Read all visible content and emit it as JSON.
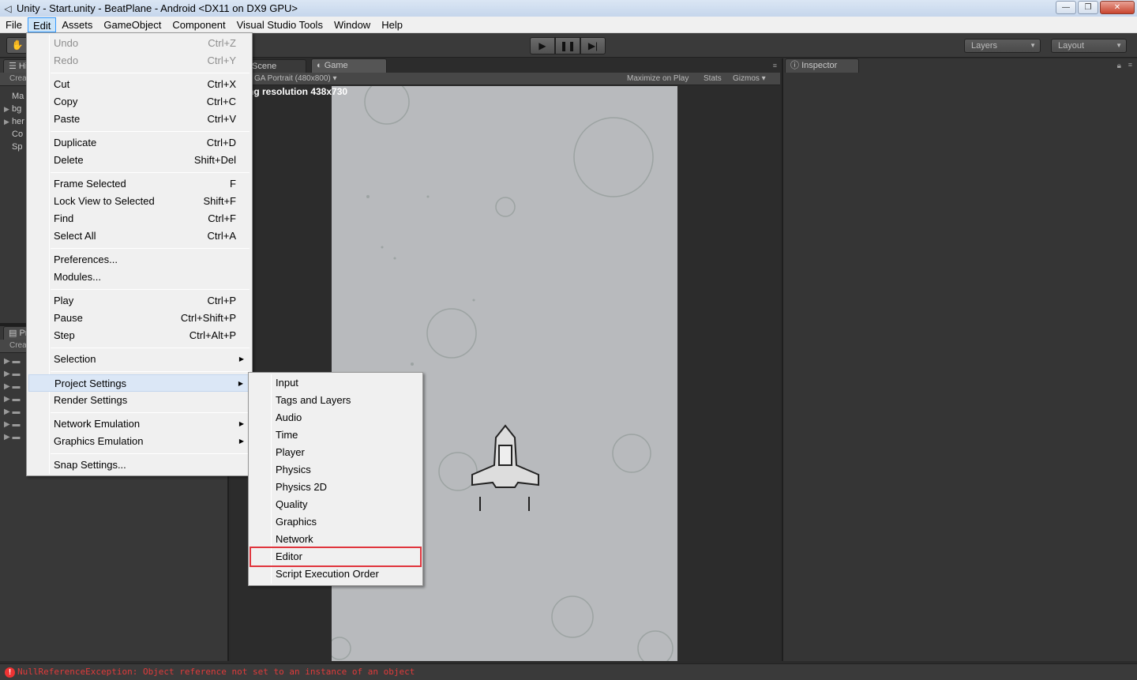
{
  "window": {
    "title": "Unity - Start.unity - BeatPlane - Android <DX11 on DX9 GPU>"
  },
  "menubar": {
    "items": [
      "File",
      "Edit",
      "Assets",
      "GameObject",
      "Component",
      "Visual Studio Tools",
      "Window",
      "Help"
    ]
  },
  "toolbar": {
    "layers_label": "Layers",
    "layout_label": "Layout"
  },
  "hierarchy": {
    "tab_label": "Hi",
    "create_label": "Crea",
    "items": [
      "Ma",
      "bg",
      "her",
      "Co",
      "Sp"
    ]
  },
  "project": {
    "tab_label": "Pr",
    "create_label": "Crea"
  },
  "scene_tabs": {
    "scene_label": "Scene",
    "game_label": "Game"
  },
  "game_bar": {
    "aspect_label": "GA Portrait (480x800)",
    "maximize_label": "Maximize on Play",
    "stats_label": "Stats",
    "gizmos_label": "Gizmos"
  },
  "game_view": {
    "resolution_warning": "ng resolution 438x730"
  },
  "inspector": {
    "tab_label": "Inspector"
  },
  "edit_menu": {
    "items": [
      {
        "label": "Undo",
        "shortcut": "Ctrl+Z",
        "disabled": true
      },
      {
        "label": "Redo",
        "shortcut": "Ctrl+Y",
        "disabled": true
      },
      {
        "label": "Cut",
        "shortcut": "Ctrl+X"
      },
      {
        "label": "Copy",
        "shortcut": "Ctrl+C"
      },
      {
        "label": "Paste",
        "shortcut": "Ctrl+V"
      },
      {
        "label": "Duplicate",
        "shortcut": "Ctrl+D"
      },
      {
        "label": "Delete",
        "shortcut": "Shift+Del"
      },
      {
        "label": "Frame Selected",
        "shortcut": "F"
      },
      {
        "label": "Lock View to Selected",
        "shortcut": "Shift+F"
      },
      {
        "label": "Find",
        "shortcut": "Ctrl+F"
      },
      {
        "label": "Select All",
        "shortcut": "Ctrl+A"
      },
      {
        "label": "Preferences...",
        "shortcut": ""
      },
      {
        "label": "Modules...",
        "shortcut": ""
      },
      {
        "label": "Play",
        "shortcut": "Ctrl+P"
      },
      {
        "label": "Pause",
        "shortcut": "Ctrl+Shift+P"
      },
      {
        "label": "Step",
        "shortcut": "Ctrl+Alt+P"
      },
      {
        "label": "Selection",
        "shortcut": ""
      },
      {
        "label": "Project Settings",
        "shortcut": ""
      },
      {
        "label": "Render Settings",
        "shortcut": ""
      },
      {
        "label": "Network Emulation",
        "shortcut": ""
      },
      {
        "label": "Graphics Emulation",
        "shortcut": ""
      },
      {
        "label": "Snap Settings...",
        "shortcut": ""
      }
    ]
  },
  "project_settings_menu": {
    "items": [
      "Input",
      "Tags and Layers",
      "Audio",
      "Time",
      "Player",
      "Physics",
      "Physics 2D",
      "Quality",
      "Graphics",
      "Network",
      "Editor",
      "Script Execution Order"
    ],
    "highlighted": "Editor"
  },
  "status": {
    "error_text": "NullReferenceException: Object reference not set to an instance of an object"
  },
  "colors": {
    "error": "#e03a3a",
    "highlight_box": "#e0353d",
    "menu_hover": "#dbe7f6"
  }
}
